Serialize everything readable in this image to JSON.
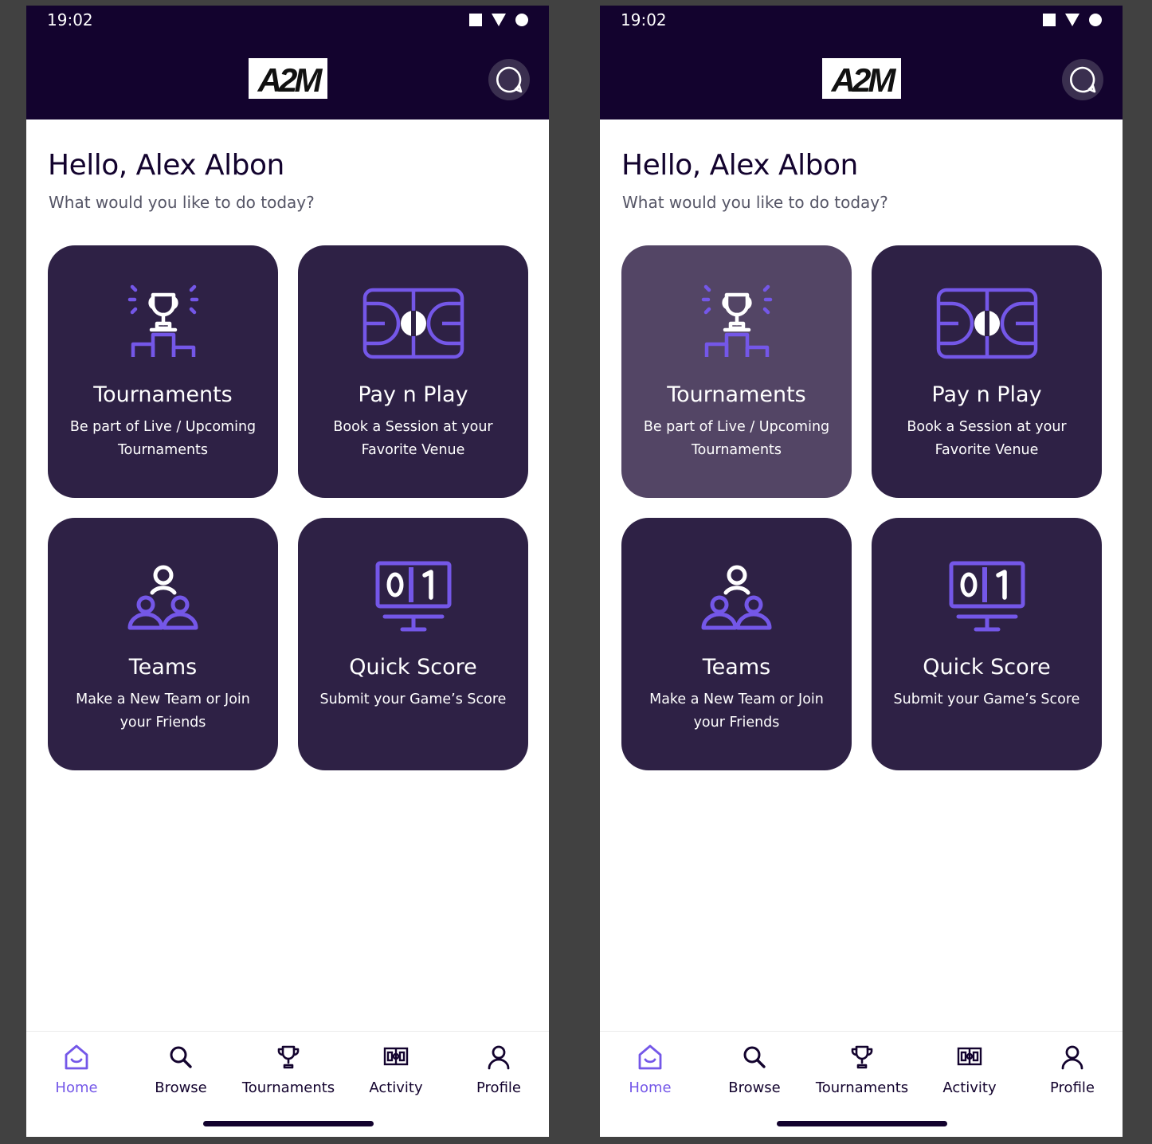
{
  "status_bar": {
    "time": "19:02"
  },
  "header": {
    "logo_text": "A2M"
  },
  "greeting": {
    "title": "Hello, Alex Albon",
    "subtitle": "What would you like to do today?"
  },
  "cards": [
    {
      "title": "Tournaments",
      "desc": "Be part of Live / Upcoming Tournaments",
      "icon": "trophy-podium-icon"
    },
    {
      "title": "Pay n Play",
      "desc": "Book a Session at your Favorite Venue",
      "icon": "court-icon"
    },
    {
      "title": "Teams",
      "desc": "Make a New Team or Join your Friends",
      "icon": "teams-icon"
    },
    {
      "title": "Quick Score",
      "desc": "Submit your Game’s Score",
      "icon": "scoreboard-icon"
    }
  ],
  "nav": [
    {
      "label": "Home",
      "icon": "home-icon",
      "active": true
    },
    {
      "label": "Browse",
      "icon": "search-icon"
    },
    {
      "label": "Tournaments",
      "icon": "trophy-icon"
    },
    {
      "label": "Activity",
      "icon": "scoreboard-icon"
    },
    {
      "label": "Profile",
      "icon": "user-icon"
    }
  ],
  "colors": {
    "header_bg": "#13032e",
    "card_bg": "#2e2145",
    "card_highlight_bg": "#534565",
    "accent": "#7457e8"
  },
  "screens": [
    {
      "highlighted_card": "none"
    },
    {
      "highlighted_card": "Tournaments"
    }
  ]
}
